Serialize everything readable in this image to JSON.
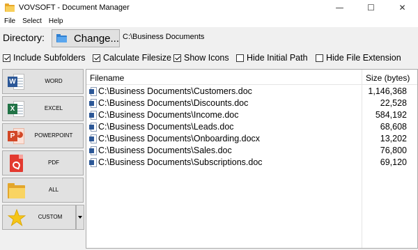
{
  "window": {
    "title": "VOVSOFT - Document Manager",
    "controls": {
      "minimize": "—",
      "maximize": "☐",
      "close": "✕"
    }
  },
  "menu": [
    "File",
    "Select",
    "Help"
  ],
  "directory": {
    "label": "Directory:",
    "change_button": "Change...",
    "path": "C:\\Business Documents"
  },
  "options": [
    {
      "label": "Include Subfolders",
      "checked": true
    },
    {
      "label": "Calculate Filesize",
      "checked": true
    },
    {
      "label": "Show Icons",
      "checked": true
    },
    {
      "label": "Hide Initial Path",
      "checked": false
    },
    {
      "label": "Hide File Extension",
      "checked": false
    }
  ],
  "file_types": [
    {
      "label": "WORD",
      "icon": "word-icon",
      "badge": "W"
    },
    {
      "label": "EXCEL",
      "icon": "excel-icon",
      "badge": "X"
    },
    {
      "label": "POWERPOINT",
      "icon": "powerpoint-icon",
      "badge": "P"
    },
    {
      "label": "PDF",
      "icon": "pdf-icon"
    },
    {
      "label": "ALL",
      "icon": "folder-icon"
    },
    {
      "label": "CUSTOM",
      "icon": "star-icon"
    }
  ],
  "file_list": {
    "columns": [
      "Filename",
      "Size (bytes)"
    ],
    "rows": [
      {
        "filename": "C:\\Business Documents\\Customers.doc",
        "size": "1,146,368"
      },
      {
        "filename": "C:\\Business Documents\\Discounts.doc",
        "size": "22,528"
      },
      {
        "filename": "C:\\Business Documents\\Income.doc",
        "size": "584,192"
      },
      {
        "filename": "C:\\Business Documents\\Leads.doc",
        "size": "68,608"
      },
      {
        "filename": "C:\\Business Documents\\Onboarding.docx",
        "size": "13,202"
      },
      {
        "filename": "C:\\Business Documents\\Sales.doc",
        "size": "76,800"
      },
      {
        "filename": "C:\\Business Documents\\Subscriptions.doc",
        "size": "69,120"
      }
    ]
  },
  "colors": {
    "word": "#2b5797",
    "excel": "#217346",
    "powerpoint": "#d24726",
    "pdf": "#e33a30",
    "folder": "#f9d462",
    "star": "#f5c518"
  }
}
